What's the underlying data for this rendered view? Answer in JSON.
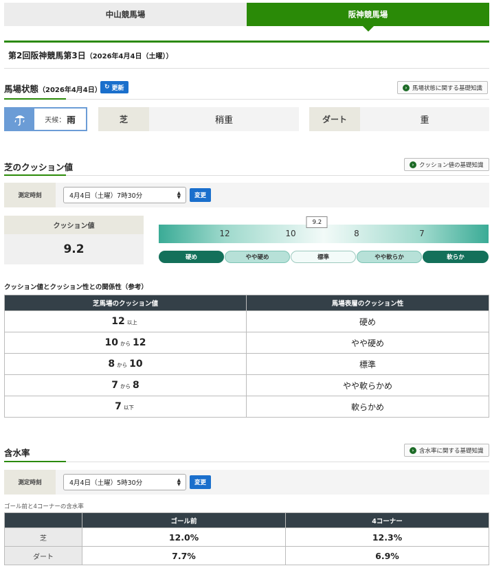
{
  "tabs": [
    {
      "label": "中山競馬場",
      "active": false
    },
    {
      "label": "阪神競馬場",
      "active": true
    }
  ],
  "race_title": {
    "main": "第2回阪神競馬第3日",
    "date": "（2026年4月4日（土曜））"
  },
  "track": {
    "title": "馬場状態",
    "date": "（2026年4月4日）",
    "refresh_label": "更新",
    "knowledge_label": "馬場状態に関する基礎知識",
    "weather_label": "天候：",
    "weather_value": "雨",
    "turf_label": "芝",
    "turf_value": "稍重",
    "dirt_label": "ダート",
    "dirt_value": "重"
  },
  "cushion": {
    "title": "芝のクッション値",
    "knowledge_label": "クッション値の基礎知識",
    "measure_label": "測定時刻",
    "select_value": "4月4日（土曜）7時30分",
    "change_label": "変更",
    "box_label": "クッション値",
    "value": "9.2",
    "scale_ticks": [
      "12",
      "10",
      "8",
      "7"
    ],
    "marker": 9.2,
    "categories": [
      "硬め",
      "やや硬め",
      "標準",
      "やや軟らか",
      "軟らか"
    ]
  },
  "reference": {
    "title": "クッション値とクッション性との関係性（参考）",
    "headers": [
      "芝馬場のクッション値",
      "馬場表層のクッション性"
    ],
    "rows": [
      {
        "a": "12",
        "sep": "以上",
        "b": "",
        "label": "硬め"
      },
      {
        "a": "10",
        "sep": "から",
        "b": "12",
        "label": "やや硬め"
      },
      {
        "a": "8",
        "sep": "から",
        "b": "10",
        "label": "標準"
      },
      {
        "a": "7",
        "sep": "から",
        "b": "8",
        "label": "やや軟らかめ"
      },
      {
        "a": "7",
        "sep": "以下",
        "b": "",
        "label": "軟らかめ"
      }
    ]
  },
  "moisture": {
    "title": "含水率",
    "knowledge_label": "含水率に関する基礎知識",
    "measure_label": "測定時刻",
    "select_value": "4月4日（土曜）5時30分",
    "change_label": "変更",
    "caption": "ゴール前と4コーナーの含水率",
    "headers": [
      "",
      "ゴール前",
      "4コーナー"
    ],
    "rows": [
      {
        "label": "芝",
        "goal": "12.0%",
        "corner": "12.3%"
      },
      {
        "label": "ダート",
        "goal": "7.7%",
        "corner": "6.9%"
      }
    ]
  }
}
